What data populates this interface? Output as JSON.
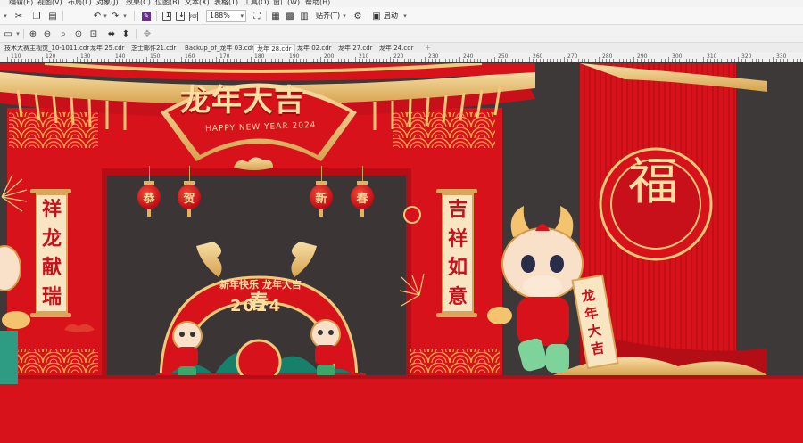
{
  "menu": {
    "items": [
      "编辑(E)",
      "视图(V)",
      "布局(L)",
      "对象(J)",
      "效果(C)",
      "位图(B)",
      "文本(X)",
      "表格(T)",
      "工具(O)",
      "窗口(W)",
      "帮助(H)"
    ]
  },
  "toolbar": {
    "zoom_value": "188%",
    "snap_label": "贴齐(T)",
    "launch_label": "启动"
  },
  "tabs": [
    {
      "label": "技术大赛主视觉_10-1011.cdr",
      "active": false
    },
    {
      "label": "龙年 25.cdr",
      "active": false
    },
    {
      "label": "芝士邮件21.cdr",
      "active": false
    },
    {
      "label": "Backup_of_龙年 03.cdr",
      "active": false
    },
    {
      "label": "龙年 28.cdr",
      "active": true
    },
    {
      "label": "龙年 02.cdr",
      "active": false
    },
    {
      "label": "龙年 27.cdr",
      "active": false
    },
    {
      "label": "龙年 24.cdr",
      "active": false
    }
  ],
  "ruler": {
    "labels": [
      "110",
      "120",
      "130",
      "140",
      "150",
      "160",
      "170",
      "180",
      "190",
      "200",
      "210",
      "220",
      "230",
      "240",
      "250",
      "260",
      "270",
      "280",
      "290",
      "300",
      "310",
      "320",
      "330"
    ]
  },
  "artwork": {
    "main_title": "龙年大吉",
    "subtitle": "HAPPY NEW YEAR 2024",
    "left_couplet": [
      "祥",
      "龙",
      "献",
      "瑞"
    ],
    "right_couplet": [
      "吉",
      "祥",
      "如",
      "意"
    ],
    "lanterns": [
      "恭",
      "贺",
      "新",
      "春"
    ],
    "arch_text": "新年快乐 龙年大吉",
    "year": "2024",
    "spring_char": "春",
    "fu_char": "福",
    "scroll_text": "龙年大吉",
    "colors": {
      "red": "#d7121b",
      "dark_red": "#b50d15",
      "gold": "#e8c07a",
      "cream": "#f8e6c3",
      "background": "#3d3939"
    }
  }
}
